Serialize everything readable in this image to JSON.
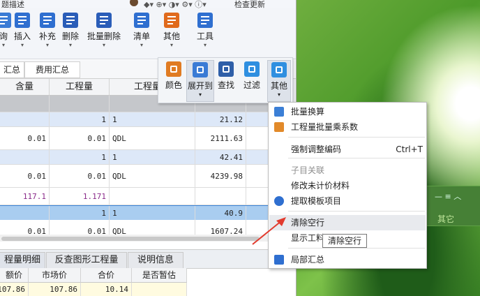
{
  "titlebar": {
    "left_text": "题描述",
    "right_text": "检查更新"
  },
  "ribbon": {
    "buttons": [
      {
        "label": "询",
        "icon": "query-icon",
        "color": "#3a7bd5"
      },
      {
        "label": "插入",
        "icon": "insert-icon",
        "color": "#2f6fd0"
      },
      {
        "label": "补充",
        "icon": "supplement-icon",
        "color": "#2f6fd0"
      },
      {
        "label": "删除",
        "icon": "delete-icon",
        "color": "#2a5db8"
      },
      {
        "label": "批量删除",
        "icon": "batch-delete-icon",
        "color": "#2a5db8"
      },
      {
        "label": "清单",
        "icon": "bill-icon",
        "color": "#2f6fd0"
      },
      {
        "label": "其他",
        "icon": "other-icon",
        "color": "#e06a1c"
      },
      {
        "label": "工具",
        "icon": "tools-icon",
        "color": "#2f6fd0"
      }
    ]
  },
  "tabs": {
    "items": [
      "汇总",
      "费用汇总"
    ]
  },
  "grid": {
    "headers": [
      "含量",
      "工程量",
      "工程量表"
    ],
    "rows": [
      {
        "type": "group",
        "c1": "",
        "c2": "",
        "c3": "",
        "c4": ""
      },
      {
        "type": "sub",
        "c1": "",
        "c2": "1",
        "c3": "1",
        "c4": "21.12"
      },
      {
        "type": "item",
        "c1": "0.01",
        "c2": "0.01",
        "c3": "QDL",
        "c4": "2111.63"
      },
      {
        "type": "sub",
        "c1": "",
        "c2": "1",
        "c3": "1",
        "c4": "42.41"
      },
      {
        "type": "item",
        "c1": "0.01",
        "c2": "0.01",
        "c3": "QDL",
        "c4": "4239.98"
      },
      {
        "type": "purple",
        "c1": "117.1",
        "c2": "1.171",
        "c3": "",
        "c4": ""
      },
      {
        "type": "selected",
        "c1": "",
        "c2": "1",
        "c3": "1",
        "c4": "40.9"
      },
      {
        "type": "item",
        "c1": "0.01",
        "c2": "0.01",
        "c3": "QDL",
        "c4": "1607.24"
      }
    ]
  },
  "bottom_tabs": {
    "items": [
      "程量明细",
      "反查图形工程量",
      "说明信息"
    ]
  },
  "bottom_grid": {
    "headers": [
      "额价",
      "市场价",
      "合价",
      "是否暂估"
    ],
    "row": [
      "107.86",
      "107.86",
      "10.14",
      ""
    ]
  },
  "subtoolbar": {
    "buttons": [
      {
        "label": "颜色",
        "icon": "paint-bucket-icon",
        "color": "#e07b22"
      },
      {
        "label": "展开到",
        "icon": "expand-tree-icon",
        "color": "#3a7bd5"
      },
      {
        "label": "查找",
        "icon": "binoculars-icon",
        "color": "#2f5fa8"
      },
      {
        "label": "过滤",
        "icon": "filter-icon",
        "color": "#2f8fe0"
      },
      {
        "label": "其他",
        "icon": "grid-icon",
        "color": "#2f8fe0"
      }
    ]
  },
  "context_menu": {
    "items": [
      {
        "label": "批量换算",
        "icon": "batch-convert-icon",
        "enabled": true,
        "shortcut": ""
      },
      {
        "label": "工程量批量乘系数",
        "icon": "multiply-icon",
        "enabled": true,
        "shortcut": ""
      },
      {
        "label": "强制调整编码",
        "icon": "",
        "enabled": true,
        "shortcut": "Ctrl+T"
      },
      {
        "label": "子目关联",
        "icon": "",
        "enabled": false,
        "shortcut": ""
      },
      {
        "label": "修改未计价材料",
        "icon": "",
        "enabled": true,
        "shortcut": ""
      },
      {
        "label": "提取模板项目",
        "icon": "template-icon",
        "enabled": true,
        "shortcut": ""
      },
      {
        "label": "清除空行",
        "icon": "",
        "enabled": true,
        "shortcut": ""
      },
      {
        "label": "显示工料",
        "icon": "",
        "enabled": true,
        "shortcut": ""
      },
      {
        "label": "局部汇总",
        "icon": "partial-sum-icon",
        "enabled": true,
        "shortcut": ""
      }
    ]
  },
  "tooltip": {
    "text": "清除空行"
  },
  "small_window": {
    "label": "其它"
  }
}
